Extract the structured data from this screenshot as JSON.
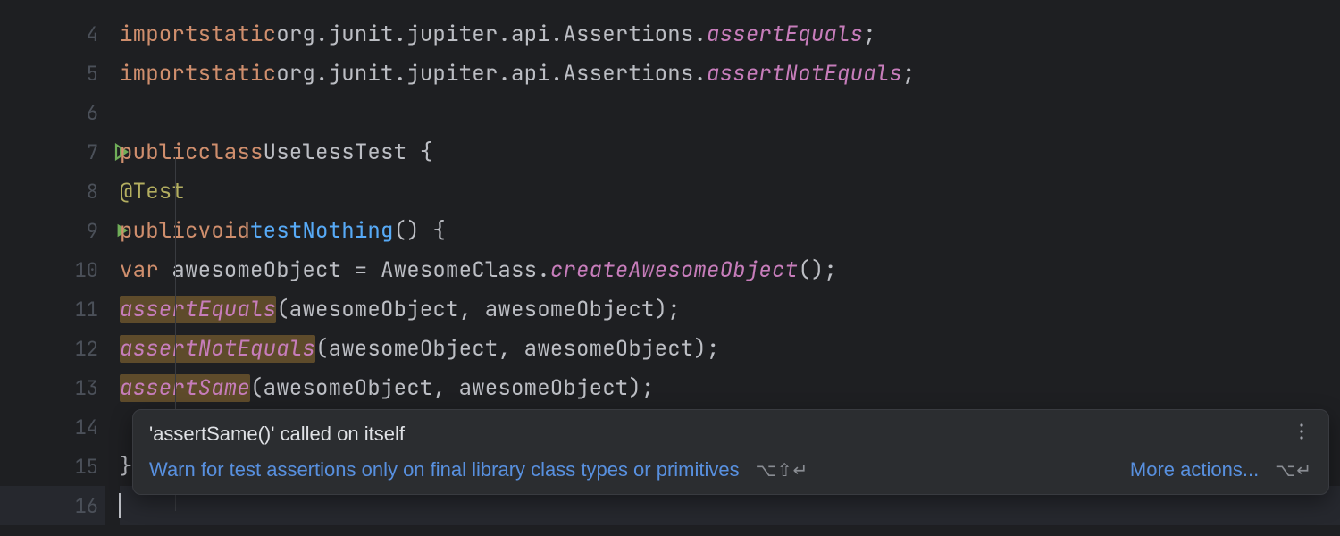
{
  "gutter": {
    "lines": [
      "4",
      "5",
      "6",
      "7",
      "8",
      "9",
      "10",
      "11",
      "12",
      "13",
      "14",
      "15",
      "16"
    ]
  },
  "code": {
    "l4": {
      "import": "import",
      "static": "static",
      "pkg": "org.junit.jupiter.api.Assertions.",
      "name": "assertEquals",
      "semi": ";"
    },
    "l5": {
      "import": "import",
      "static": "static",
      "pkg": "org.junit.jupiter.api.Assertions.",
      "name": "assertNotEquals",
      "semi": ";"
    },
    "l7": {
      "public": "public",
      "class": "class",
      "name": "UselessTest",
      "brace": " {"
    },
    "l8": {
      "annotation": "@Test"
    },
    "l9": {
      "public": "public",
      "void": "void",
      "name": "testNothing",
      "rest": "() {"
    },
    "l10": {
      "var": "var",
      "ident": " awesomeObject ",
      "eq": "= ",
      "cls": "AwesomeClass.",
      "call": "createAwesomeObject",
      "rest": "();"
    },
    "l11": {
      "call": "assertEquals",
      "rest": "(awesomeObject, awesomeObject);"
    },
    "l12": {
      "call": "assertNotEquals",
      "rest": "(awesomeObject, awesomeObject);"
    },
    "l13": {
      "call": "assertSame",
      "rest": "(awesomeObject, awesomeObject);"
    },
    "l14": {
      "brace": "    }"
    },
    "l15": {
      "brace": "}"
    }
  },
  "tooltip": {
    "title": "'assertSame()' called on itself",
    "suggestion": "Warn for test assertions only on final library class types or primitives",
    "shortcut1": "⌥⇧↵",
    "more": "More actions...",
    "shortcut2": "⌥↵"
  }
}
